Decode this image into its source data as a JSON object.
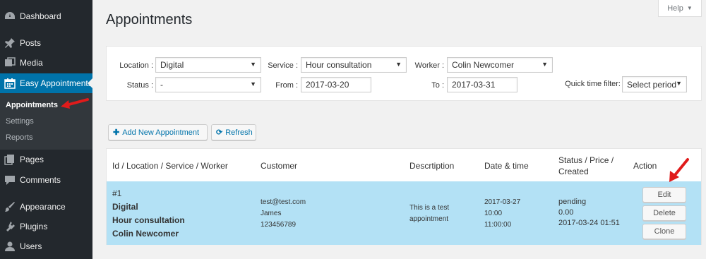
{
  "sidebar": {
    "items": [
      {
        "label": "Dashboard",
        "icon": "dashboard-icon"
      },
      {
        "label": "Posts",
        "icon": "pin-icon"
      },
      {
        "label": "Media",
        "icon": "media-icon"
      },
      {
        "label": "Easy Appointments",
        "icon": "calendar-icon"
      },
      {
        "label": "Pages",
        "icon": "pages-icon"
      },
      {
        "label": "Comments",
        "icon": "comment-icon"
      },
      {
        "label": "Appearance",
        "icon": "brush-icon"
      },
      {
        "label": "Plugins",
        "icon": "plugin-icon"
      },
      {
        "label": "Users",
        "icon": "user-icon"
      }
    ],
    "submenu": [
      "Appointments",
      "Settings",
      "Reports"
    ]
  },
  "header": {
    "title": "Appointments",
    "help": "Help"
  },
  "filters": {
    "location_label": "Location :",
    "location_value": "Digital",
    "service_label": "Service :",
    "service_value": "Hour consultation",
    "worker_label": "Worker :",
    "worker_value": "Colin Newcomer",
    "status_label": "Status :",
    "status_value": "-",
    "from_label": "From :",
    "from_value": "2017-03-20",
    "to_label": "To :",
    "to_value": "2017-03-31",
    "quick_label": "Quick time filter:",
    "quick_value": "Select period"
  },
  "actions": {
    "add_label": "Add New Appointment",
    "refresh_label": "Refresh"
  },
  "table": {
    "headers": [
      "Id / Location / Service / Worker",
      "Customer",
      "Descrtiption",
      "Date & time",
      "Status / Price / Created",
      "Action"
    ],
    "row": {
      "id": "#1",
      "location": "Digital",
      "service": "Hour consultation",
      "worker": "Colin Newcomer",
      "customer_email": "test@test.com",
      "customer_name": "James",
      "customer_phone": "123456789",
      "description": "This is a test appointment",
      "date": "2017-03-27",
      "start": "10:00",
      "end": "11:00:00",
      "status": "pending",
      "price": "0.00",
      "created": "2017-03-24 01:51",
      "buttons": {
        "edit": "Edit",
        "delete": "Delete",
        "clone": "Clone"
      }
    }
  },
  "colors": {
    "sidebar_bg": "#23282d",
    "active": "#0073aa",
    "row_highlight": "#b3e1f5",
    "annotation_arrow": "#e01b1b"
  }
}
